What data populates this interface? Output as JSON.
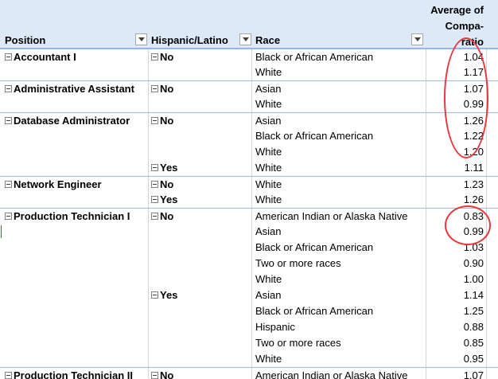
{
  "header": {
    "position": "Position",
    "hispanic": "Hispanic/Latino",
    "race": "Race",
    "measure_lines": [
      "Average of",
      "Compa-",
      "ratio"
    ]
  },
  "rows": [
    {
      "position": "Accountant I",
      "hispanic": "No",
      "race": "Black or African American",
      "value": "1.04"
    },
    {
      "position": "",
      "hispanic": "",
      "race": "White",
      "value": "1.17"
    },
    {
      "position": "Administrative Assistant",
      "hispanic": "No",
      "race": "Asian",
      "value": "1.07"
    },
    {
      "position": "",
      "hispanic": "",
      "race": "White",
      "value": "0.99"
    },
    {
      "position": "Database Administrator",
      "hispanic": "No",
      "race": "Asian",
      "value": "1.26"
    },
    {
      "position": "",
      "hispanic": "",
      "race": "Black or African American",
      "value": "1.22"
    },
    {
      "position": "",
      "hispanic": "",
      "race": "White",
      "value": "1.20"
    },
    {
      "position": "",
      "hispanic": "Yes",
      "race": "White",
      "value": "1.11"
    },
    {
      "position": "Network Engineer",
      "hispanic": "No",
      "race": "White",
      "value": "1.23"
    },
    {
      "position": "",
      "hispanic": "Yes",
      "race": "White",
      "value": "1.26"
    },
    {
      "position": "Production Technician I",
      "hispanic": "No",
      "race": "American Indian or Alaska Native",
      "value": "0.83"
    },
    {
      "position": "",
      "hispanic": "",
      "race": "Asian",
      "value": "0.99"
    },
    {
      "position": "",
      "hispanic": "",
      "race": "Black or African American",
      "value": "1.03"
    },
    {
      "position": "",
      "hispanic": "",
      "race": "Two or more races",
      "value": "0.90"
    },
    {
      "position": "",
      "hispanic": "",
      "race": "White",
      "value": "1.00"
    },
    {
      "position": "",
      "hispanic": "Yes",
      "race": "Asian",
      "value": "1.14"
    },
    {
      "position": "",
      "hispanic": "",
      "race": "Black or African American",
      "value": "1.25"
    },
    {
      "position": "",
      "hispanic": "",
      "race": "Hispanic",
      "value": "0.88"
    },
    {
      "position": "",
      "hispanic": "",
      "race": "Two or more races",
      "value": "0.85"
    },
    {
      "position": "",
      "hispanic": "",
      "race": "White",
      "value": "0.95"
    },
    {
      "position": "Production Technician II",
      "hispanic": "No",
      "race": "American Indian or Alaska Native",
      "value": "1.07"
    }
  ],
  "colors": {
    "header_bg": "#dde9f6",
    "separator": "#9bbbe0",
    "annotation": "#e8383e"
  }
}
